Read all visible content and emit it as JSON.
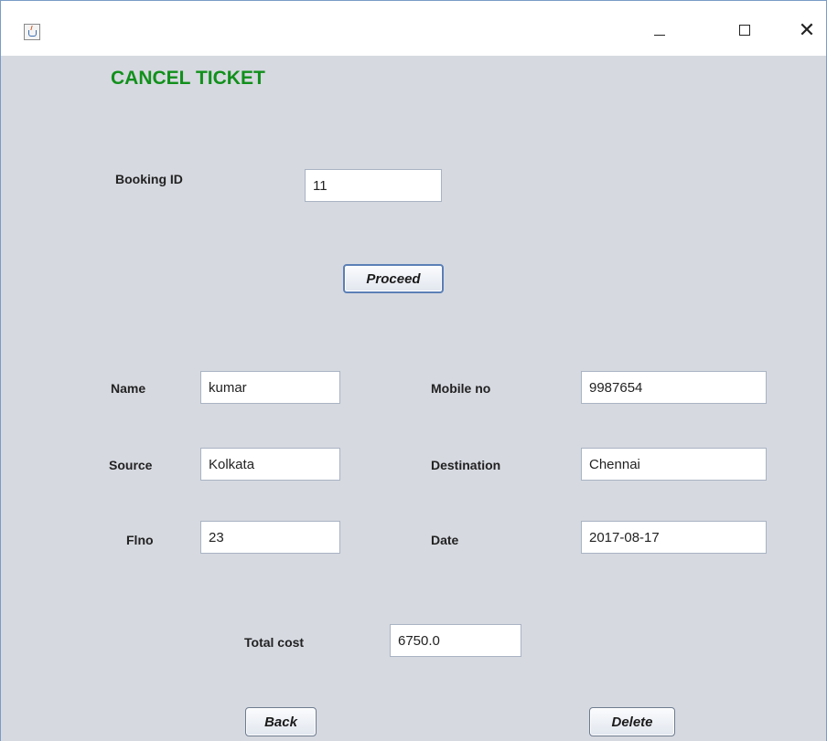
{
  "window": {
    "app_icon": "java-cup-icon",
    "controls": {
      "minimize": "minimize-icon",
      "maximize": "maximize-icon",
      "close": "close-icon",
      "close_glyph": "✕"
    }
  },
  "form": {
    "title": "CANCEL TICKET",
    "booking_id_label": "Booking ID",
    "booking_id_value": "11",
    "proceed_label": "Proceed",
    "name_label": "Name",
    "name_value": "kumar",
    "mobile_label": "Mobile no",
    "mobile_value": "9987654",
    "source_label": "Source",
    "source_value": "Kolkata",
    "destination_label": "Destination",
    "destination_value": "Chennai",
    "flno_label": "Flno",
    "flno_value": "23",
    "date_label": "Date",
    "date_value": "2017-08-17",
    "total_cost_label": "Total cost",
    "total_cost_value": "6750.0",
    "back_label": "Back",
    "delete_label": "Delete"
  },
  "colors": {
    "title": "#11901b",
    "background": "#d6d9e0"
  }
}
